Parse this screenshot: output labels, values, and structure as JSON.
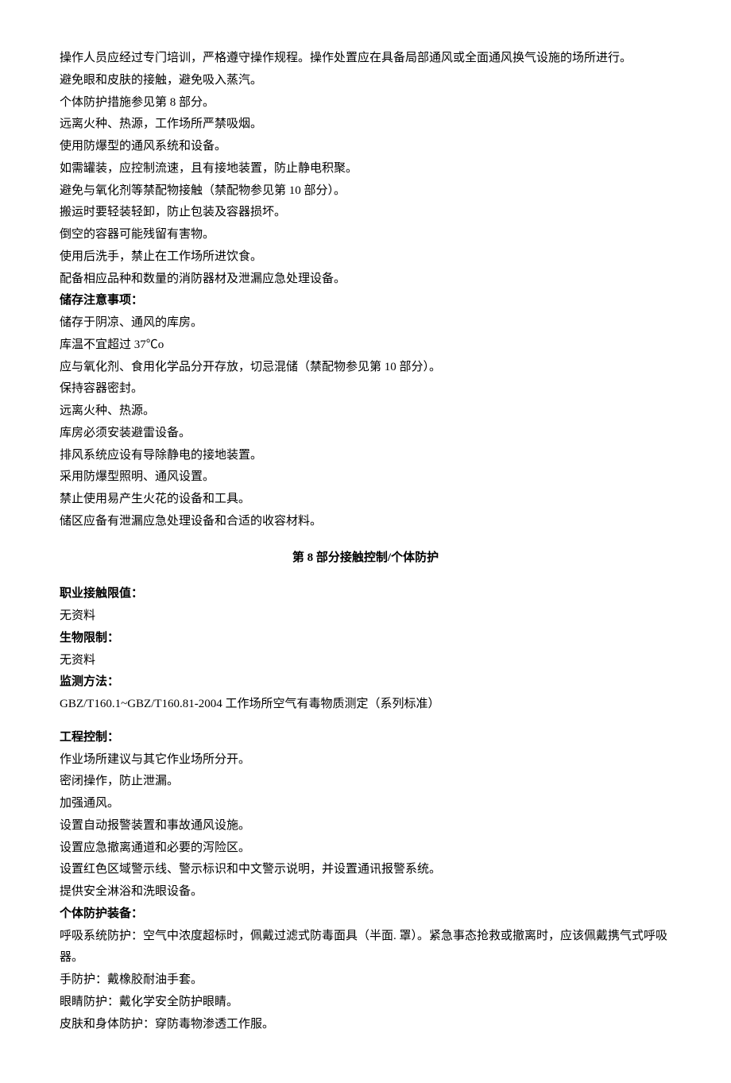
{
  "handling": {
    "lines": [
      "操作人员应经过专门培训，严格遵守操作规程。操作处置应在具备局部通风或全面通风换气设施的场所进行。",
      "避免眼和皮肤的接触，避免吸入蒸汽。",
      "个体防护措施参见第 8 部分。",
      "远离火种、热源，工作场所严禁吸烟。",
      "使用防爆型的通风系统和设备。",
      "如需罐装，应控制流速，且有接地装置，防止静电积聚。",
      "避免与氧化剂等禁配物接触（禁配物参见第 10 部分）。",
      "搬运时要轻装轻卸，防止包装及容器损坏。",
      "倒空的容器可能残留有害物。",
      "使用后洗手，禁止在工作场所进饮食。",
      "配备相应品种和数量的消防器材及泄漏应急处理设备。"
    ]
  },
  "storage": {
    "heading": "储存注意事项：",
    "lines": [
      "储存于阴凉、通风的库房。",
      "库温不宜超过 37℃o",
      "应与氧化剂、食用化学品分开存放，切忌混储（禁配物参见第 10 部分）。",
      "保持容器密封。",
      "远离火种、热源。",
      "库房必须安装避雷设备。",
      "排风系统应设有导除静电的接地装置。",
      "采用防爆型照明、通风设置。",
      "禁止使用易产生火花的设备和工具。",
      "储区应备有泄漏应急处理设备和合适的收容材料。"
    ]
  },
  "section8": {
    "title": "第 8 部分接触控制/个体防护",
    "occ_limit_label": "职业接触限值：",
    "occ_limit_value": "无资料",
    "bio_limit_label": "生物限制：",
    "bio_limit_value": "无资料",
    "monitor_label": "监测方法：",
    "monitor_value": "GBZ/T160.1~GBZ/T160.81-2004 工作场所空气有毒物质测定（系列标准）",
    "eng_control_label": "工程控制：",
    "eng_control_lines": [
      "作业场所建议与其它作业场所分开。",
      "密闭操作，防止泄漏。",
      "加强通风。",
      "设置自动报警装置和事故通风设施。",
      "设置应急撤离通道和必要的泻险区。",
      "设置红色区域警示线、警示标识和中文警示说明，并设置通讯报警系统。",
      "提供安全淋浴和洗眼设备。"
    ],
    "ppe_label": "个体防护装备：",
    "ppe_lines": [
      "呼吸系统防护：空气中浓度超标时，佩戴过滤式防毒面具（半面. 罩）。紧急事态抢救或撤离时，应该佩戴携气式呼吸器。",
      "手防护：戴橡胶耐油手套。",
      "眼睛防护：戴化学安全防护眼睛。",
      "皮肤和身体防护：穿防毒物渗透工作服。"
    ]
  }
}
